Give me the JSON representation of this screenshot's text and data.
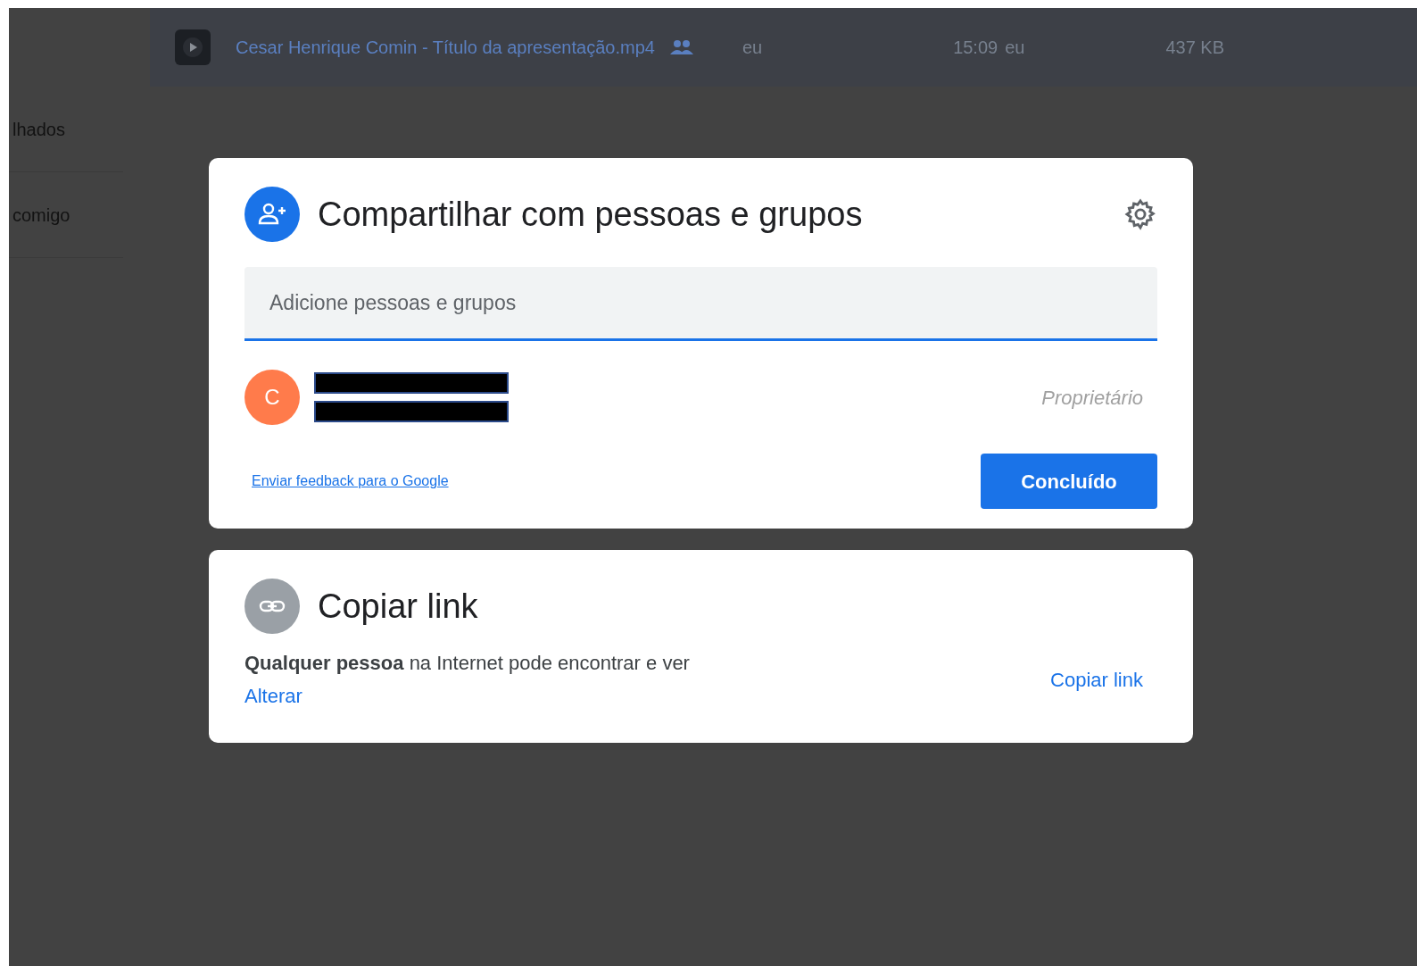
{
  "file_row": {
    "name": "Cesar Henrique Comin - Título da apresentação.mp4",
    "shared": true,
    "owner": "eu",
    "modified": "15:09",
    "modified_by": "eu",
    "size": "437 KB"
  },
  "sidebar": {
    "items": [
      {
        "label": "lhados"
      },
      {
        "label": "comigo"
      }
    ]
  },
  "share_dialog": {
    "title": "Compartilhar com pessoas e grupos",
    "search": {
      "placeholder": "Adicione pessoas e grupos"
    },
    "people": [
      {
        "initial": "C",
        "color": "#ff7b4b",
        "role": "Proprietário",
        "redacted": true
      }
    ],
    "feedback_link": "Enviar feedback para o Google",
    "done_button": "Concluído"
  },
  "link_dialog": {
    "title": "Copiar link",
    "access": "**Qualquer pessoa** na Internet pode encontrar e ver",
    "change_link": "Alterar",
    "copy_button": "Copiar link"
  }
}
